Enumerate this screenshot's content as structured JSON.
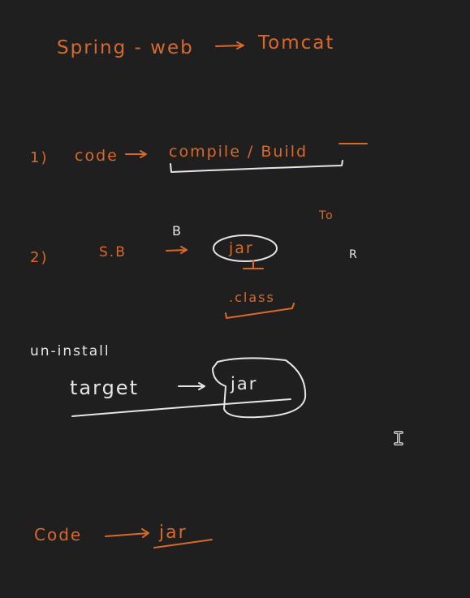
{
  "colors": {
    "background": "#1f1f1f",
    "orange_ink": "#d9692b",
    "white_ink": "#e6e6e6"
  },
  "notes": {
    "line1": {
      "left": "Spring - web",
      "right": "Tomcat"
    },
    "line2": {
      "num": "1)",
      "left": "code",
      "right": "compile / Build"
    },
    "line3": {
      "mark_b": "B",
      "mark_to": "To",
      "mark_r": "R",
      "num": "2)",
      "left": "S.B",
      "right": "jar",
      "below": ".class"
    },
    "line4": {
      "title": "un-install",
      "left": "target",
      "right": "jar"
    },
    "line5": {
      "left": "Code",
      "right": "jar"
    }
  },
  "cursor_icon": "text-cursor-icon"
}
